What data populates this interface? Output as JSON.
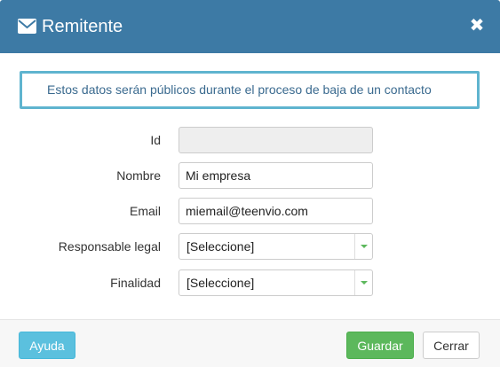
{
  "dialog": {
    "title": "Remitente",
    "header_icon": "envelope-icon",
    "close_glyph": "✖",
    "colors": {
      "header": "#3d7aa5",
      "info_border": "#5fb4cf",
      "help_button": "#5bc0de",
      "save_button": "#5cb85c"
    }
  },
  "info": {
    "message": "Estos datos serán públicos durante el proceso de baja de un contacto"
  },
  "form": {
    "id": {
      "label": "Id",
      "value": ""
    },
    "nombre": {
      "label": "Nombre",
      "value": "Mi empresa"
    },
    "email": {
      "label": "Email",
      "value": "miemail@teenvio.com"
    },
    "responsable": {
      "label": "Responsable legal",
      "selected": "[Seleccione]"
    },
    "finalidad": {
      "label": "Finalidad",
      "selected": "[Seleccione]"
    }
  },
  "footer": {
    "help_label": "Ayuda",
    "save_label": "Guardar",
    "close_label": "Cerrar"
  }
}
